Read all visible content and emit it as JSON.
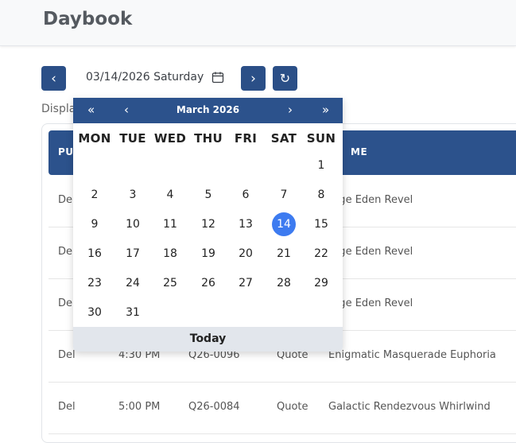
{
  "header": {
    "title": "Daybook"
  },
  "toolbar": {
    "date": "03/14/2026 Saturday",
    "prev": "‹",
    "next": "›",
    "refresh": "↻"
  },
  "display_label": "Displa",
  "table": {
    "headers": [
      "PU",
      "ME"
    ],
    "rows": [
      {
        "type": "Del",
        "time": "",
        "number": "",
        "kind": "",
        "name": "rage Eden Revel"
      },
      {
        "type": "Del",
        "time": "",
        "number": "",
        "kind": "",
        "name": "rage Eden Revel"
      },
      {
        "type": "Del",
        "time": "",
        "number": "",
        "kind": "",
        "name": "rage Eden Revel"
      },
      {
        "type": "Del",
        "time": "4:30 PM",
        "number": "Q26-0096",
        "kind": "Quote",
        "name": "Enigmatic Masquerade Euphoria"
      },
      {
        "type": "Del",
        "time": "5:00 PM",
        "number": "Q26-0084",
        "kind": "Quote",
        "name": "Galactic Rendezvous Whirlwind"
      }
    ]
  },
  "datepicker": {
    "month_label": "March 2026",
    "nav": {
      "prev_year": "«",
      "prev_month": "‹",
      "next_month": "›",
      "next_year": "»"
    },
    "weekdays": [
      "MON",
      "TUE",
      "WED",
      "THU",
      "FRI",
      "SAT",
      "SUN"
    ],
    "weeks": [
      [
        "",
        "",
        "",
        "",
        "",
        "",
        "1"
      ],
      [
        "2",
        "3",
        "4",
        "5",
        "6",
        "7",
        "8"
      ],
      [
        "9",
        "10",
        "11",
        "12",
        "13",
        "14",
        "15"
      ],
      [
        "16",
        "17",
        "18",
        "19",
        "20",
        "21",
        "22"
      ],
      [
        "23",
        "24",
        "25",
        "26",
        "27",
        "28",
        "29"
      ],
      [
        "30",
        "31",
        "",
        "",
        "",
        "",
        ""
      ]
    ],
    "selected": "14",
    "today_label": "Today",
    "selected_color": "#3d7bf0"
  },
  "colors": {
    "primary": "#2c528c"
  }
}
